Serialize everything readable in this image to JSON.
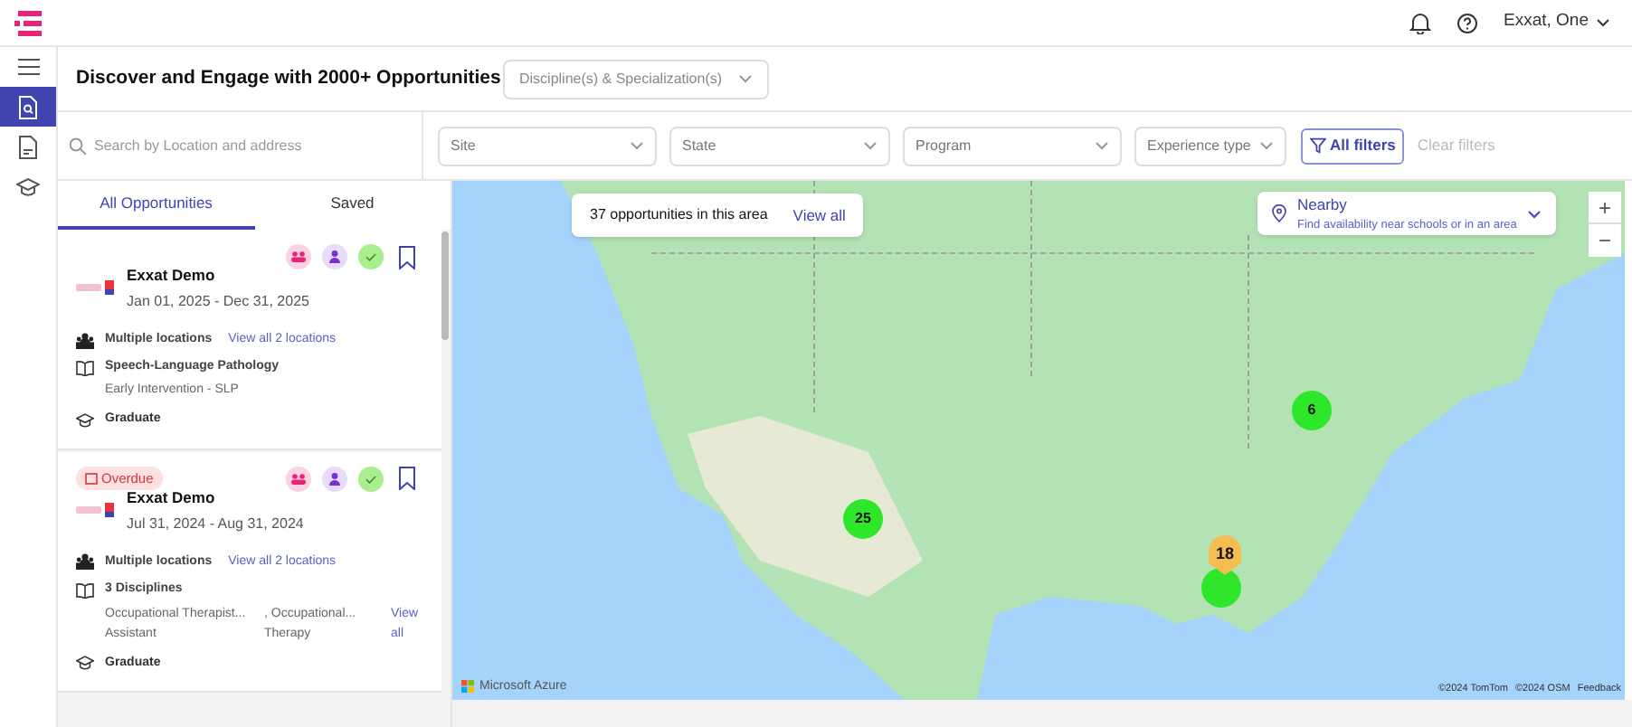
{
  "header": {
    "user": "Exxat, One"
  },
  "nav": [
    {
      "kind": "menu",
      "selected": false
    },
    {
      "kind": "search-doc",
      "selected": true
    },
    {
      "kind": "doc",
      "selected": false
    },
    {
      "kind": "cap",
      "selected": false
    }
  ],
  "page": {
    "title": "Discover and Engage with 2000+ Opportunities",
    "discipline_select": {
      "placeholder": "Discipline(s) & Specialization(s)"
    }
  },
  "search": {
    "placeholder": "Search by Location and address"
  },
  "filters": [
    {
      "placeholder": "Site"
    },
    {
      "placeholder": "State"
    },
    {
      "placeholder": "Program"
    },
    {
      "placeholder": "Experience type"
    }
  ],
  "all_filters": "All filters",
  "clear_filters": {
    "label": "Clear filters",
    "disabled": true
  },
  "tabs": [
    {
      "label": "All Opportunities",
      "selected": true
    },
    {
      "label": "Saved",
      "selected": false
    }
  ],
  "cards": [
    {
      "org": "Exxat Demo",
      "dates": "Jan 01, 2025 - Dec 31, 2025",
      "location": "Multiple locations",
      "location_link": "View all 2 locations",
      "discipline": {
        "kind": "single",
        "title": "Speech-Language Pathology",
        "items": [
          "Early Intervention - SLP"
        ]
      },
      "level": "Graduate"
    },
    {
      "tag": "Overdue",
      "org": "Exxat Demo",
      "dates": "Jul 31, 2024 - Aug 31, 2024",
      "location": "Multiple locations",
      "location_link": "View all 2 locations",
      "discipline": {
        "kind": "multi",
        "title": "3 Disciplines",
        "items": [
          "Occupational Therapist... Assistant",
          ", Occupational... Therapy"
        ],
        "more": "View all"
      },
      "level": "Graduate"
    }
  ],
  "map": {
    "count_text": "37 opportunities in this area",
    "view_all": "View all",
    "nearby": {
      "title": "Nearby",
      "subtitle": "Find availability near schools or in an area"
    },
    "zoom_in": "+",
    "zoom_out": "−",
    "markers": [
      {
        "kind": "cluster",
        "label": "25"
      },
      {
        "kind": "cluster",
        "label": "6"
      },
      {
        "kind": "cluster"
      },
      {
        "kind": "pin",
        "label": "18"
      }
    ],
    "brand": "Microsoft Azure",
    "attribution": [
      "©2024 TomTom",
      "©2024 OSM",
      "Feedback"
    ]
  }
}
